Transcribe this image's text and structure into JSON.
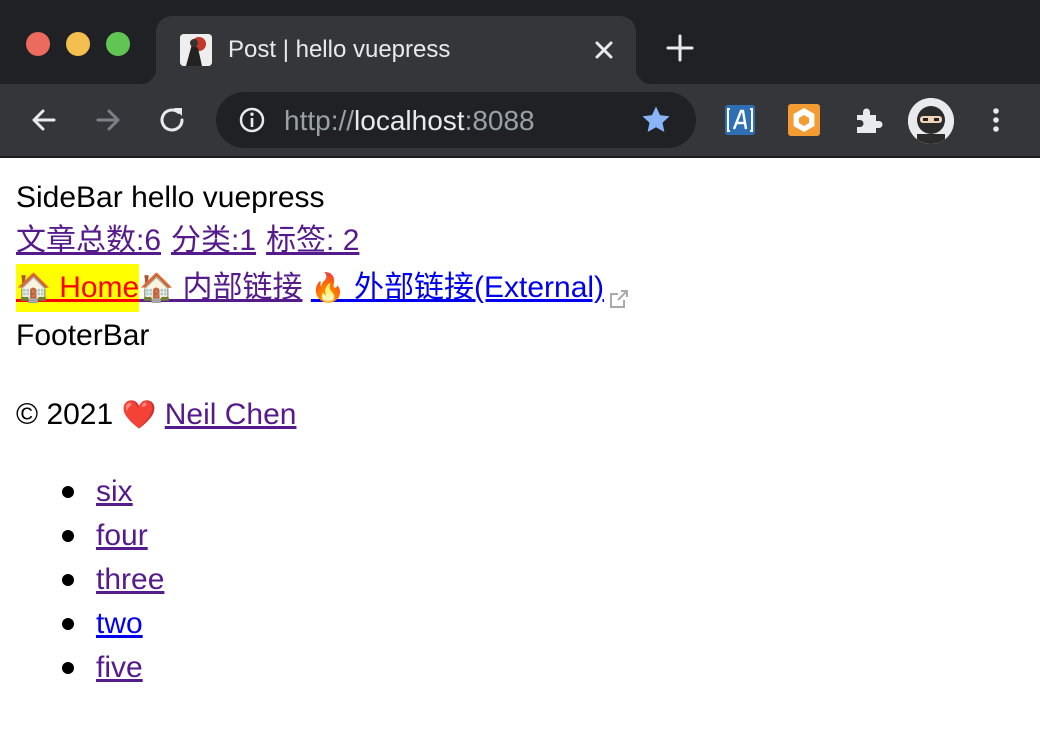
{
  "browser": {
    "tab_title": "Post | hello vuepress",
    "url_scheme": "http://",
    "url_host": "localhost",
    "url_port": ":8088",
    "colors": {
      "frame": "#202124",
      "toolbar": "#35363a",
      "star": "#8ab4f8"
    }
  },
  "page": {
    "sidebar_title": "SideBar hello vuepress",
    "stats": {
      "articles": "文章总数:6",
      "categories": "分类:1",
      "tags": "标签: 2"
    },
    "nav": {
      "home_emoji": "🏠",
      "home_label": " Home",
      "internal_emoji": "🏠",
      "internal_label": " 内部链接 ",
      "external_emoji": "🔥",
      "external_label": " 外部链接(External) "
    },
    "footer_bar": "FooterBar",
    "copyright": {
      "prefix": "© 2021 ",
      "heart": "❤️",
      "author": "Neil Chen"
    },
    "posts": [
      "six",
      "four",
      "three",
      "two",
      "five"
    ]
  }
}
